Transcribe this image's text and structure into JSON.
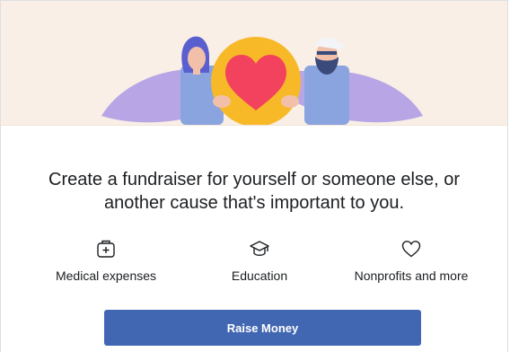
{
  "headline": "Create a fundraiser for yourself or someone else, or another cause that's important to you.",
  "features": [
    {
      "icon": "medical-kit-icon",
      "label": "Medical expenses"
    },
    {
      "icon": "graduation-cap-icon",
      "label": "Education"
    },
    {
      "icon": "heart-outline-icon",
      "label": "Nonprofits and more"
    }
  ],
  "cta": {
    "label": "Raise Money"
  },
  "colors": {
    "button": "#4267b2",
    "hero_bg": "#f9efe6",
    "heart": "#f2425e",
    "heart_ring": "#f7b928",
    "arms": "#b7a5e6"
  }
}
